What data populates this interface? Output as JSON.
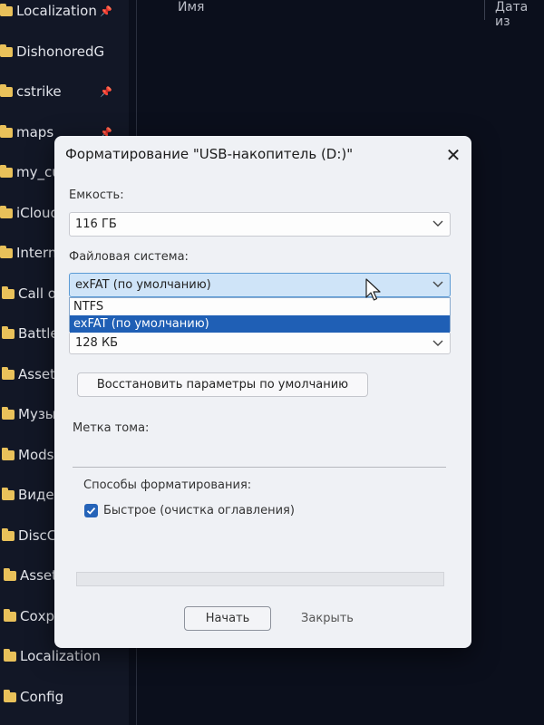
{
  "explorer": {
    "sidebar_items": [
      {
        "label": "Localization",
        "icon": "folder-icon",
        "pinned": true
      },
      {
        "label": "DishonoredG",
        "icon": "folder-icon",
        "pinned": false
      },
      {
        "label": "cstrike",
        "icon": "folder-icon",
        "pinned": true
      },
      {
        "label": "maps",
        "icon": "folder-icon",
        "pinned": true
      },
      {
        "label": "my_cus",
        "icon": "folder-icon",
        "pinned": false
      },
      {
        "label": "iCloud",
        "icon": "folder-icon",
        "pinned": false
      },
      {
        "label": "Interna",
        "icon": "folder-icon",
        "pinned": false
      },
      {
        "label": "Call of",
        "icon": "folder-icon",
        "pinned": false
      },
      {
        "label": "Battlefi",
        "icon": "folder-icon",
        "pinned": false
      },
      {
        "label": "Asset",
        "icon": "folder-icon",
        "pinned": false
      },
      {
        "label": "Музык",
        "icon": "folder-icon",
        "pinned": false
      },
      {
        "label": "Mods",
        "icon": "folder-icon",
        "pinned": false
      },
      {
        "label": "Видео",
        "icon": "folder-icon",
        "pinned": false
      },
      {
        "label": "DiscCo",
        "icon": "folder-icon",
        "pinned": false
      },
      {
        "label": "Asset",
        "icon": "folder-icon",
        "pinned": false
      },
      {
        "label": "Сохран",
        "icon": "folder-icon",
        "pinned": false
      },
      {
        "label": "Localization",
        "icon": "folder-icon",
        "pinned": false
      },
      {
        "label": "Config",
        "icon": "folder-icon",
        "pinned": false
      }
    ],
    "columns": {
      "name": "Имя",
      "date": "Дата из"
    }
  },
  "dialog": {
    "title": "Форматирование \"USB-накопитель (D:)\"",
    "capacity_label": "Емкость:",
    "capacity_value": "116 ГБ",
    "fs_label": "Файловая система:",
    "fs_value": "exFAT (по умолчанию)",
    "fs_options": [
      {
        "label": "NTFS",
        "selected": false
      },
      {
        "label": "exFAT (по умолчанию)",
        "selected": true
      }
    ],
    "cluster_value": "128 КБ",
    "restore_button": "Восстановить параметры по умолчанию",
    "volume_label": "Метка тома:",
    "volume_value": "",
    "format_options_label": "Способы форматирования:",
    "quick_format_label": "Быстрое (очистка оглавления)",
    "quick_format_checked": true,
    "progress": 0,
    "start_button": "Начать",
    "close_button": "Закрыть"
  },
  "colors": {
    "accent": "#2563b8",
    "selection": "#1f5fb5",
    "dialog_bg": "#eff1f5",
    "explorer_bg": "#0b0f1c"
  }
}
